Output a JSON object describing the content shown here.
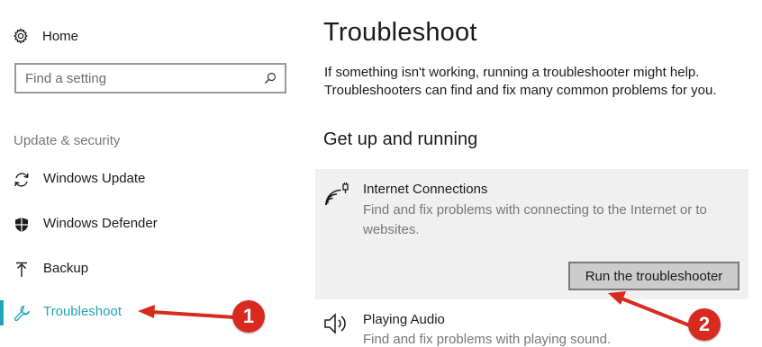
{
  "sidebar": {
    "home_label": "Home",
    "search_placeholder": "Find a setting",
    "section_heading": "Update & security",
    "items": [
      {
        "label": "Windows Update",
        "icon": "sync-icon",
        "active": false
      },
      {
        "label": "Windows Defender",
        "icon": "shield-icon",
        "active": false
      },
      {
        "label": "Backup",
        "icon": "upload-arrow-icon",
        "active": false
      },
      {
        "label": "Troubleshoot",
        "icon": "wrench-icon",
        "active": true
      }
    ]
  },
  "main": {
    "title": "Troubleshoot",
    "intro_line1": "If something isn't working, running a troubleshooter might help.",
    "intro_line2": "Troubleshooters can find and fix many common problems for you.",
    "section_heading": "Get up and running",
    "troubleshooters": [
      {
        "title": "Internet Connections",
        "description": "Find and fix problems with connecting to the Internet or to websites.",
        "icon": "network-signal-icon",
        "expanded": true,
        "button_label": "Run the troubleshooter"
      },
      {
        "title": "Playing Audio",
        "description": "Find and fix problems with playing sound.",
        "icon": "speaker-icon",
        "expanded": false
      }
    ]
  },
  "annotations": {
    "step1": "1",
    "step2": "2"
  },
  "colors": {
    "accent": "#1fa5b7",
    "annotation_red": "#d82a1f",
    "card_background": "#f0f0f0",
    "secondary_text": "#767676"
  }
}
